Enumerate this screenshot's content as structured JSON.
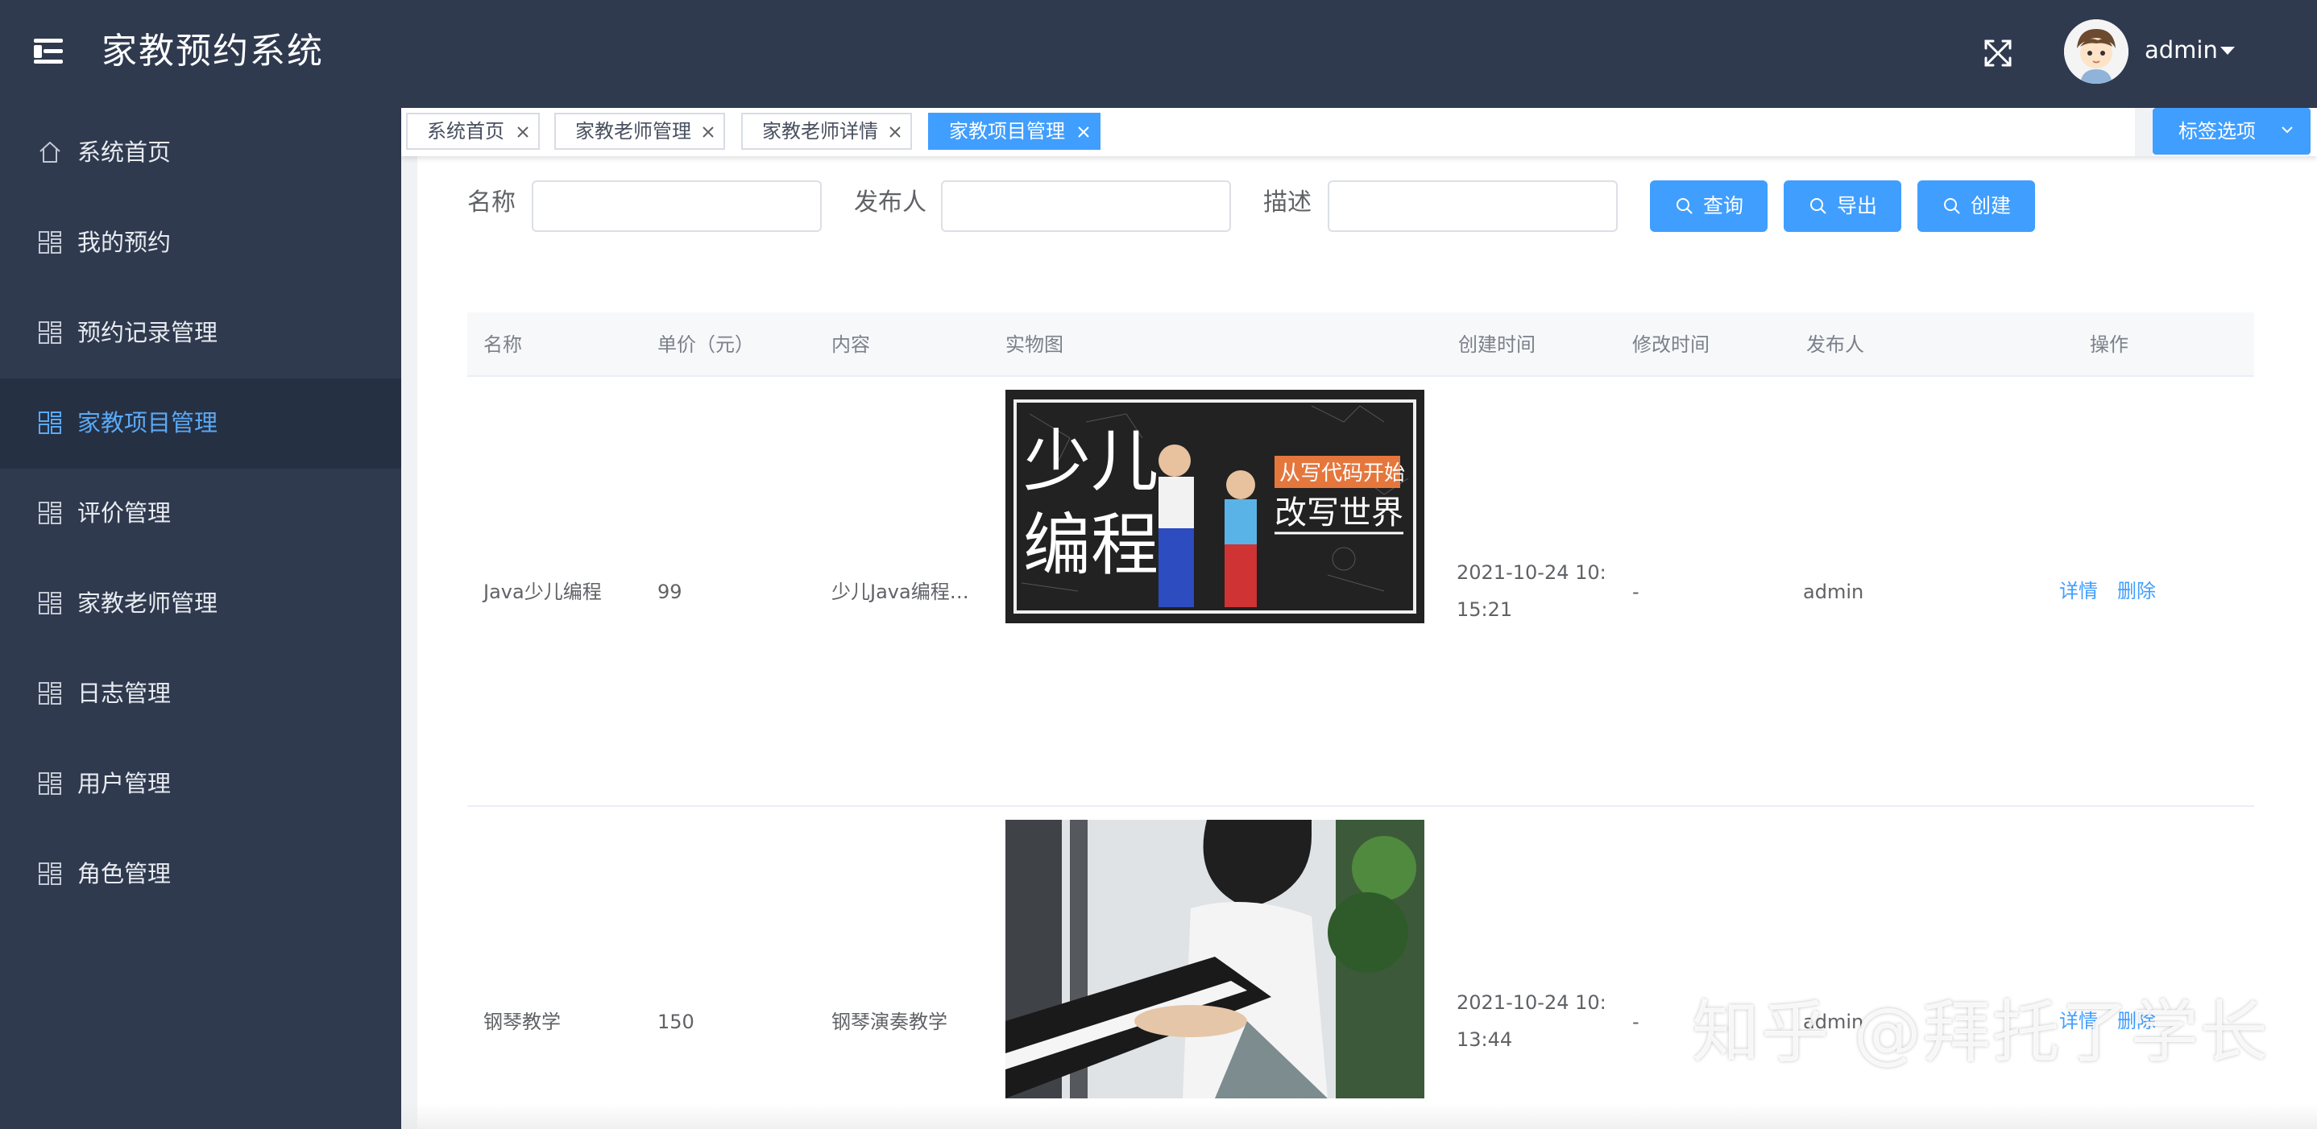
{
  "header": {
    "title": "家教预约系统",
    "user": "admin"
  },
  "sidebar": {
    "items": [
      {
        "label": "系统首页",
        "icon": "home-icon"
      },
      {
        "label": "我的预约",
        "icon": "grid-icon"
      },
      {
        "label": "预约记录管理",
        "icon": "grid-icon"
      },
      {
        "label": "家教项目管理",
        "icon": "grid-icon",
        "active": true
      },
      {
        "label": "评价管理",
        "icon": "grid-icon"
      },
      {
        "label": "家教老师管理",
        "icon": "grid-icon"
      },
      {
        "label": "日志管理",
        "icon": "grid-icon"
      },
      {
        "label": "用户管理",
        "icon": "grid-icon"
      },
      {
        "label": "角色管理",
        "icon": "grid-icon"
      }
    ]
  },
  "tags": {
    "items": [
      "系统首页",
      "家教老师管理",
      "家教老师详情",
      "家教项目管理"
    ],
    "active_index": 3,
    "options_label": "标签选项"
  },
  "search": {
    "name_label": "名称",
    "name_value": "",
    "publisher_label": "发布人",
    "publisher_value": "",
    "desc_label": "描述",
    "desc_value": "",
    "query_button": "查询",
    "export_button": "导出",
    "create_button": "创建"
  },
  "table": {
    "columns": [
      "名称",
      "单价（元）",
      "内容",
      "实物图",
      "创建时间",
      "修改时间",
      "发布人",
      "操作"
    ],
    "rows": [
      {
        "name": "Java少儿编程",
        "price": "99",
        "content": "少儿Java编程…",
        "image": {
          "title_line1": "少儿",
          "title_line2": "编程",
          "badge": "从写代码开始",
          "slogan": "改写世界"
        },
        "created_line1": "2021-10-24 10:",
        "created_line2": "15:21",
        "modified": "-",
        "publisher": "admin",
        "detail": "详情",
        "delete": "删除"
      },
      {
        "name": "钢琴教学",
        "price": "150",
        "content": "钢琴演奏教学",
        "created_line1": "2021-10-24 10:",
        "created_line2": "13:44",
        "modified": "-",
        "publisher": "admin",
        "detail": "详情",
        "delete": "删除"
      }
    ]
  },
  "watermark": "知乎 @拜托了学长",
  "colors": {
    "header_bg": "#2f3a4f",
    "sidebar_active_bg": "#263043",
    "accent": "#409eff",
    "active_text": "#5aa9f5"
  }
}
